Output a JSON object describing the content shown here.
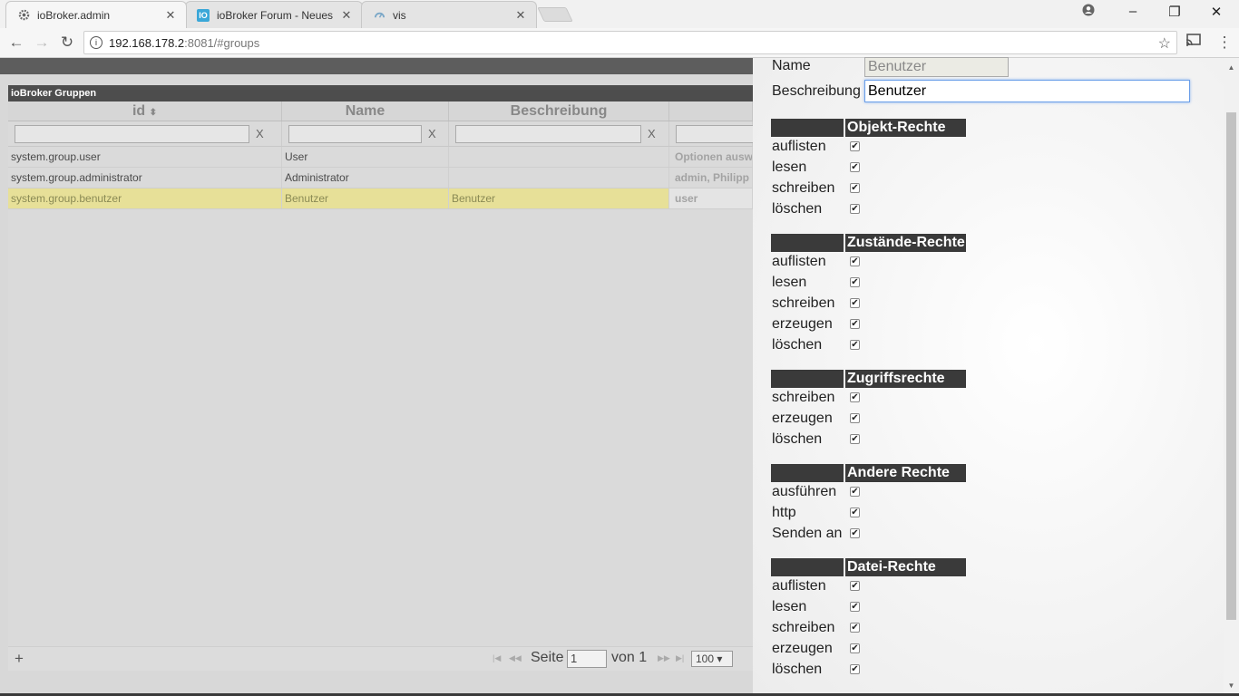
{
  "browser": {
    "tabs": [
      {
        "title": "ioBroker.admin",
        "favicon": "gear-icon"
      },
      {
        "title": "ioBroker Forum - Neues",
        "favicon": "iobroker-icon"
      },
      {
        "title": "vis",
        "favicon": "vis-icon"
      }
    ],
    "url_host": "192.168.178.2",
    "url_path": ":8081/#groups"
  },
  "panel": {
    "title": "ioBroker Gruppen",
    "columns": [
      "id",
      "Name",
      "Beschreibung"
    ],
    "filter_clear": "X",
    "rows": [
      {
        "id": "system.group.user",
        "name": "User",
        "description": "",
        "members": "Optionen ausw"
      },
      {
        "id": "system.group.administrator",
        "name": "Administrator",
        "description": "",
        "members": "admin, Philipp"
      },
      {
        "id": "system.group.benutzer",
        "name": "Benutzer",
        "description": "Benutzer",
        "members": "user"
      }
    ],
    "pager": {
      "add": "+",
      "page_label": "Seite",
      "page_value": "1",
      "of_label": "von 1",
      "per_page": "100 ▾"
    }
  },
  "dialog": {
    "name_label": "Name",
    "name_value": "Benutzer",
    "desc_label": "Beschreibung",
    "desc_value": "Benutzer",
    "sections": [
      {
        "title": "Objekt-Rechte",
        "perms": [
          "auflisten",
          "lesen",
          "schreiben",
          "löschen"
        ]
      },
      {
        "title": "Zustände-Rechte",
        "perms": [
          "auflisten",
          "lesen",
          "schreiben",
          "erzeugen",
          "löschen"
        ]
      },
      {
        "title": "Zugriffsrechte",
        "perms": [
          "schreiben",
          "erzeugen",
          "löschen"
        ]
      },
      {
        "title": "Andere Rechte",
        "perms": [
          "ausführen",
          "http",
          "Senden an"
        ]
      },
      {
        "title": "Datei-Rechte",
        "perms": [
          "auflisten",
          "lesen",
          "schreiben",
          "erzeugen",
          "löschen"
        ]
      }
    ]
  }
}
